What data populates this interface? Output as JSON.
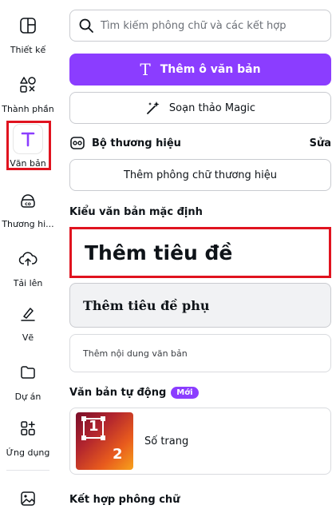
{
  "rail": {
    "items": [
      {
        "label": "Thiết kế",
        "icon": "layout-icon"
      },
      {
        "label": "Thành phần",
        "icon": "elements-icon"
      },
      {
        "label": "Văn bản",
        "icon": "text-icon",
        "active": true
      },
      {
        "label": "Thương hi...",
        "icon": "brand-icon"
      },
      {
        "label": "Tải lên",
        "icon": "upload-cloud-icon"
      },
      {
        "label": "Vẽ",
        "icon": "draw-icon"
      },
      {
        "label": "Dự án",
        "icon": "folder-icon"
      },
      {
        "label": "Ứng dụng",
        "icon": "apps-icon"
      },
      {
        "label": "",
        "icon": "image-icon"
      }
    ]
  },
  "search": {
    "placeholder": "Tìm kiếm phông chữ và các kết hợp"
  },
  "add_textbox": {
    "label": "Thêm ô văn bản"
  },
  "magic_write": {
    "label": "Soạn thảo Magic"
  },
  "brand_kit": {
    "title": "Bộ thương hiệu",
    "edit": "Sửa",
    "add_font": "Thêm phông chữ thương hiệu"
  },
  "default_styles": {
    "title": "Kiểu văn bản mặc định",
    "heading": "Thêm tiêu đề",
    "subheading": "Thêm tiêu đề phụ",
    "body": "Thêm nội dung văn bản"
  },
  "auto_text": {
    "title": "Văn bản tự động",
    "badge": "Mới",
    "item_label": "Số trang",
    "thumb_numbers": [
      "1",
      "2"
    ]
  },
  "font_combos": {
    "title": "Kết hợp phông chữ"
  },
  "colors": {
    "accent": "#8b3dff",
    "highlight": "#e0131f"
  }
}
